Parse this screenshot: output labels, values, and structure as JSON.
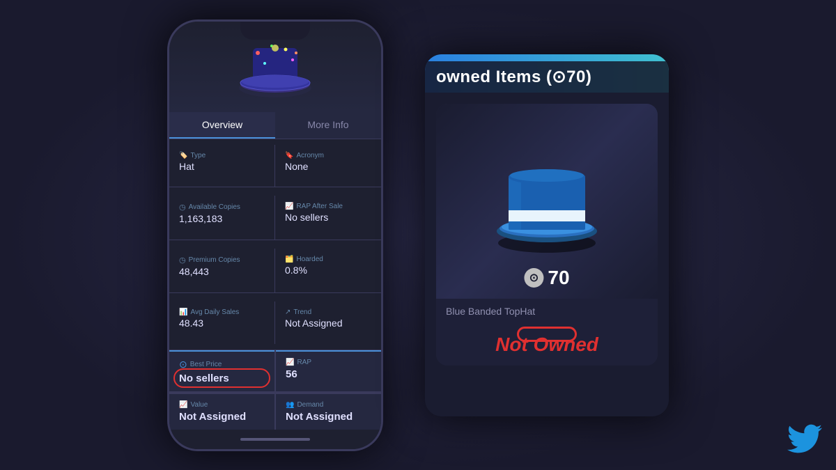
{
  "background": {
    "color": "#1a1a2e"
  },
  "phone": {
    "tabs": {
      "overview": "Overview",
      "more_info": "More Info"
    },
    "info_items": [
      {
        "label": "Type",
        "value": "Hat",
        "icon": "🏷️",
        "side": "left"
      },
      {
        "label": "Acronym",
        "value": "None",
        "icon": "🔖",
        "side": "right"
      },
      {
        "label": "Available Copies",
        "value": "1,163,183",
        "icon": "◷",
        "side": "left"
      },
      {
        "label": "RAP After Sale",
        "value": "No sellers",
        "icon": "📈",
        "side": "right"
      },
      {
        "label": "Premium Copies",
        "value": "48,443",
        "icon": "◷",
        "side": "left"
      },
      {
        "label": "Hoarded",
        "value": "0.8%",
        "icon": "🗂️",
        "side": "right"
      },
      {
        "label": "Avg Daily Sales",
        "value": "48.43",
        "icon": "📊",
        "side": "left"
      },
      {
        "label": "Trend",
        "value": "Not Assigned",
        "icon": "↗",
        "side": "right"
      }
    ],
    "cards": [
      {
        "label": "Best Price",
        "value": "No sellers",
        "icon": "🔵",
        "highlighted": true,
        "circled": true
      },
      {
        "label": "RAP",
        "value": "56",
        "icon": "📈",
        "highlighted": true,
        "circled": false
      },
      {
        "label": "Value",
        "value": "Not Assigned",
        "icon": "📈",
        "highlighted": false,
        "circled": false
      },
      {
        "label": "Demand",
        "value": "Not Assigned",
        "icon": "👥",
        "highlighted": false,
        "circled": false
      }
    ]
  },
  "app_card": {
    "header_text": "owned Items (⊙70)",
    "item_name": "Blue Banded TopHat",
    "item_price": "70",
    "not_owned_text": "Not Owned"
  }
}
